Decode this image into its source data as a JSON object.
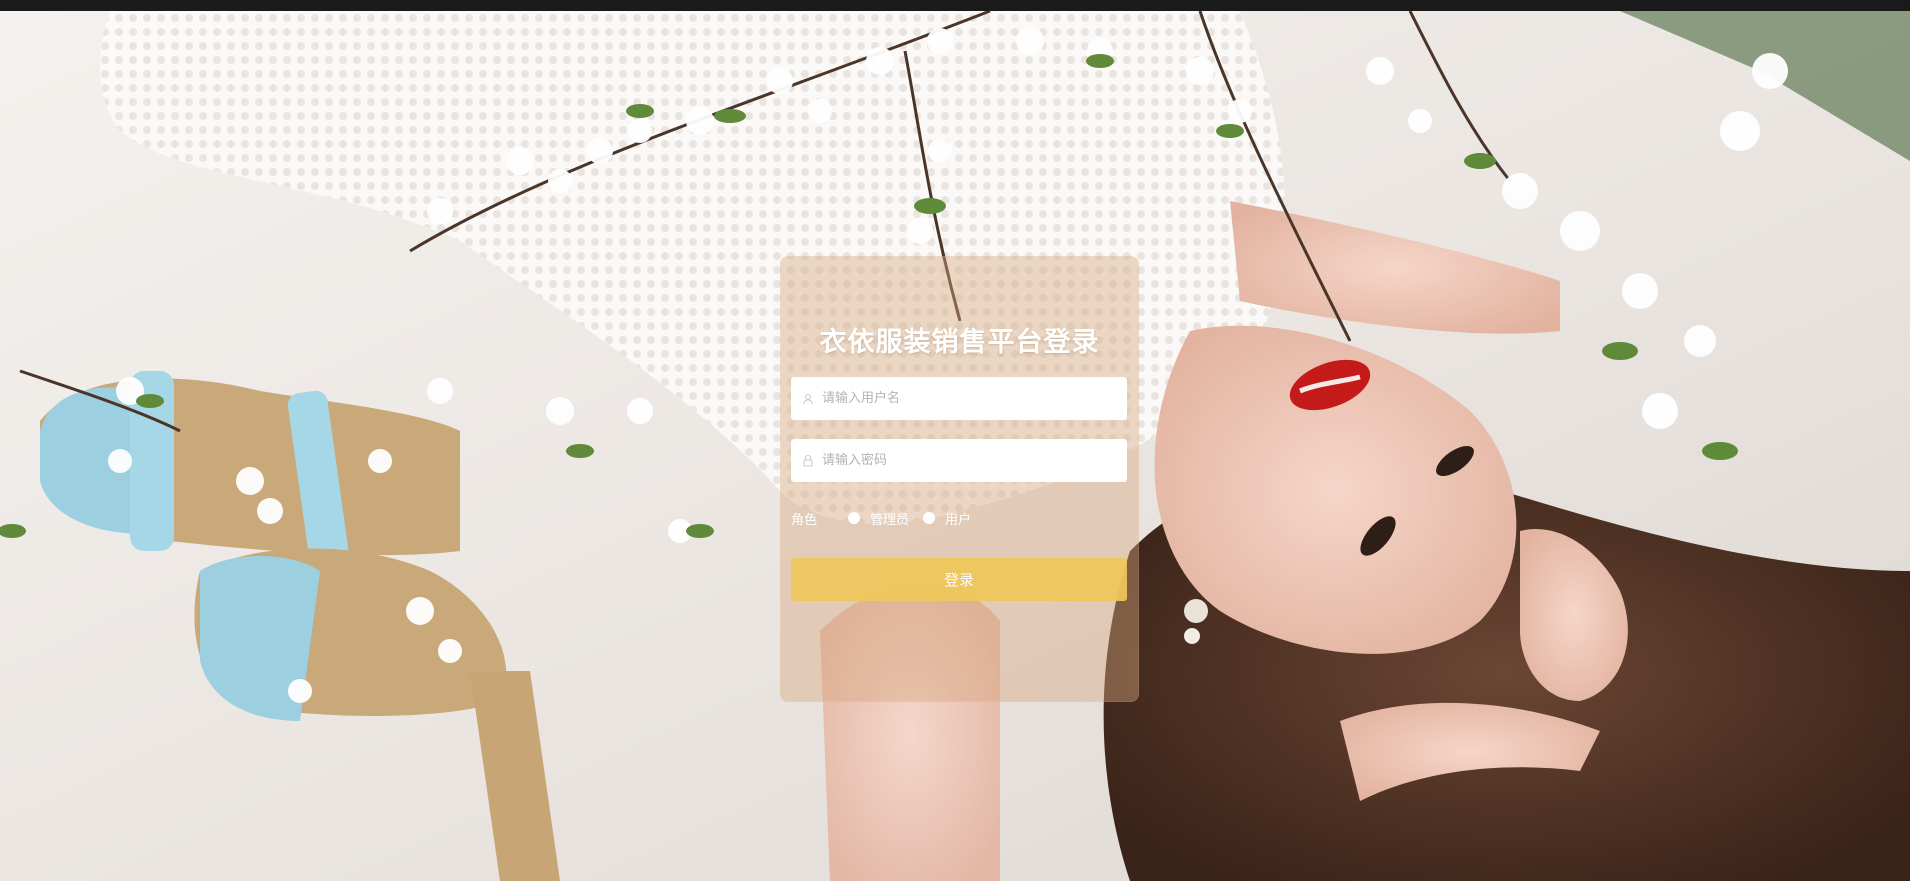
{
  "login": {
    "title": "衣依服装销售平台登录",
    "username_placeholder": "请输入用户名",
    "password_placeholder": "请输入密码",
    "role_label": "角色",
    "roles": [
      "管理员",
      "用户"
    ],
    "submit_label": "登录"
  },
  "colors": {
    "panel": "#d6a87e",
    "button": "#f0c75a",
    "text": "#ffffff"
  },
  "icons": {
    "username": "user-icon",
    "password": "lock-icon"
  }
}
